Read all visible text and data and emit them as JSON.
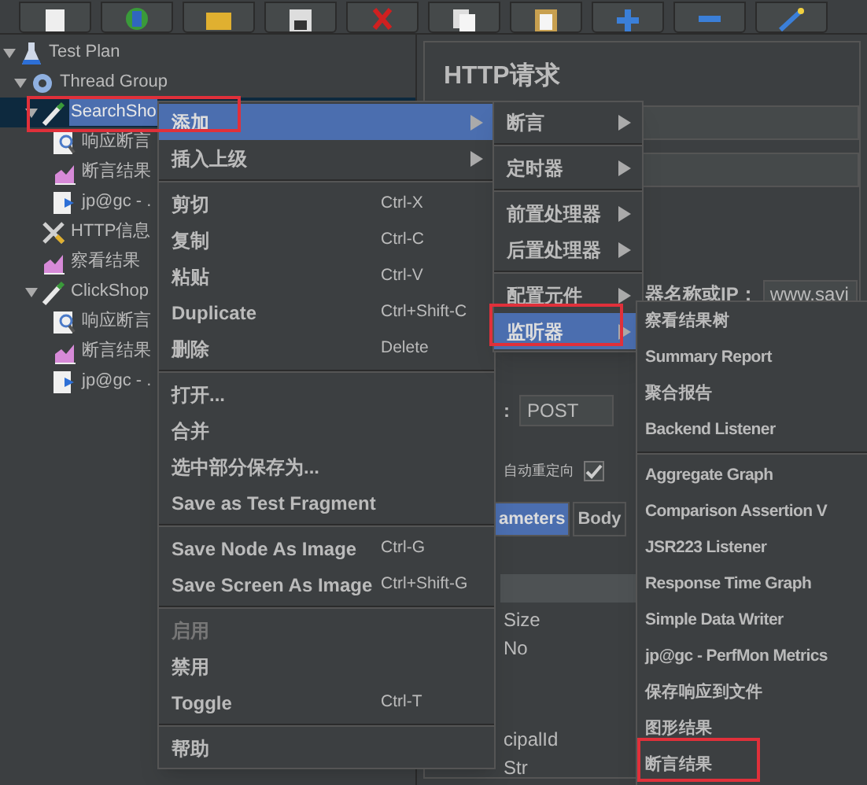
{
  "toolbar": {
    "buttons": [
      {
        "kind": "new"
      },
      {
        "kind": "template"
      },
      {
        "kind": "open"
      },
      {
        "kind": "save"
      },
      {
        "kind": "cut"
      },
      {
        "kind": "copy"
      },
      {
        "kind": "paste"
      },
      {
        "kind": "expand"
      },
      {
        "kind": "collapse"
      },
      {
        "kind": "toggle"
      }
    ]
  },
  "tree": [
    {
      "label": "Test Plan",
      "kind": "plan",
      "selected": false,
      "expanded": true,
      "children": [
        {
          "label": "Thread Group",
          "kind": "thread-group",
          "selected": false,
          "expanded": true,
          "children": [
            {
              "label": "SearchSho",
              "kind": "sampler",
              "selected": true,
              "expanded": true,
              "highlighted": true,
              "children": [
                {
                  "label": "响应断言",
                  "kind": "assertion",
                  "selected": false
                },
                {
                  "label": "断言结果",
                  "kind": "listener",
                  "selected": false
                },
                {
                  "label": "jp@gc - .",
                  "kind": "perfmon",
                  "selected": false
                }
              ]
            },
            {
              "label": "HTTP信息",
              "kind": "config",
              "selected": false
            },
            {
              "label": "察看结果",
              "kind": "listener",
              "selected": false
            },
            {
              "label": "ClickShop",
              "kind": "sampler",
              "selected": false,
              "expanded": true,
              "children": [
                {
                  "label": "响应断言",
                  "kind": "assertion",
                  "selected": false
                },
                {
                  "label": "断言结果",
                  "kind": "listener",
                  "selected": false
                },
                {
                  "label": "jp@gc - .",
                  "kind": "perfmon",
                  "selected": false
                }
              ]
            }
          ]
        }
      ]
    }
  ],
  "panel": {
    "title": "HTTP请求",
    "server_label": "器名称或IP：",
    "server_value": "www.savi",
    "method_label": ":",
    "method_value": "POST",
    "redirect_label": "自动重定向",
    "redirect_checked": true,
    "tabs": [
      {
        "label": "ameters",
        "selected": true
      },
      {
        "label": "Body",
        "selected": false
      }
    ],
    "table_rows": [
      "Size",
      "No",
      "cipalId",
      "Str"
    ]
  },
  "context_menu": [
    {
      "label": "添加",
      "submenu": true,
      "selected": true,
      "highlighted": true
    },
    {
      "label": "插入上级",
      "submenu": true,
      "selected": false,
      "separator_after": true
    },
    {
      "label": "剪切",
      "shortcut": "Ctrl-X",
      "selected": false
    },
    {
      "label": "复制",
      "shortcut": "Ctrl-C",
      "selected": false
    },
    {
      "label": "粘贴",
      "shortcut": "Ctrl-V",
      "selected": false
    },
    {
      "label": "Duplicate",
      "shortcut": "Ctrl+Shift-C",
      "selected": false
    },
    {
      "label": "删除",
      "shortcut": "Delete",
      "selected": false,
      "separator_after": true
    },
    {
      "label": "打开...",
      "selected": false
    },
    {
      "label": "合并",
      "selected": false
    },
    {
      "label": "选中部分保存为...",
      "selected": false
    },
    {
      "label": "Save as Test Fragment",
      "selected": false,
      "separator_after": true
    },
    {
      "label": "Save Node As Image",
      "shortcut": "Ctrl-G",
      "selected": false
    },
    {
      "label": "Save Screen As Image",
      "shortcut": "Ctrl+Shift-G",
      "selected": false,
      "separator_after": true
    },
    {
      "label": "启用",
      "selected": false,
      "disabled": true
    },
    {
      "label": "禁用",
      "selected": false
    },
    {
      "label": "Toggle",
      "shortcut": "Ctrl-T",
      "selected": false,
      "separator_after": true
    },
    {
      "label": "帮助",
      "selected": false
    }
  ],
  "add_submenu": [
    {
      "label": "断言",
      "selected": false,
      "separator_after": true
    },
    {
      "label": "定时器",
      "selected": false,
      "separator_after": true
    },
    {
      "label": "前置处理器",
      "selected": false
    },
    {
      "label": "后置处理器",
      "selected": false,
      "separator_after": true
    },
    {
      "label": "配置元件",
      "selected": false
    },
    {
      "label": "监听器",
      "selected": true,
      "highlighted": true
    }
  ],
  "listener_submenu": [
    {
      "label": "察看结果树",
      "selected": false
    },
    {
      "label": "Summary Report",
      "selected": false
    },
    {
      "label": "聚合报告",
      "selected": false
    },
    {
      "label": "Backend Listener",
      "selected": false,
      "separator_after": true
    },
    {
      "label": "Aggregate Graph",
      "selected": false
    },
    {
      "label": "Comparison Assertion V",
      "selected": false
    },
    {
      "label": "JSR223 Listener",
      "selected": false
    },
    {
      "label": "Response Time Graph",
      "selected": false
    },
    {
      "label": "Simple Data Writer",
      "selected": false
    },
    {
      "label": "jp@gc - PerfMon Metrics",
      "selected": false
    },
    {
      "label": "保存响应到文件",
      "selected": false
    },
    {
      "label": "图形结果",
      "selected": false
    },
    {
      "label": "断言结果",
      "selected": false,
      "highlighted": true
    }
  ]
}
